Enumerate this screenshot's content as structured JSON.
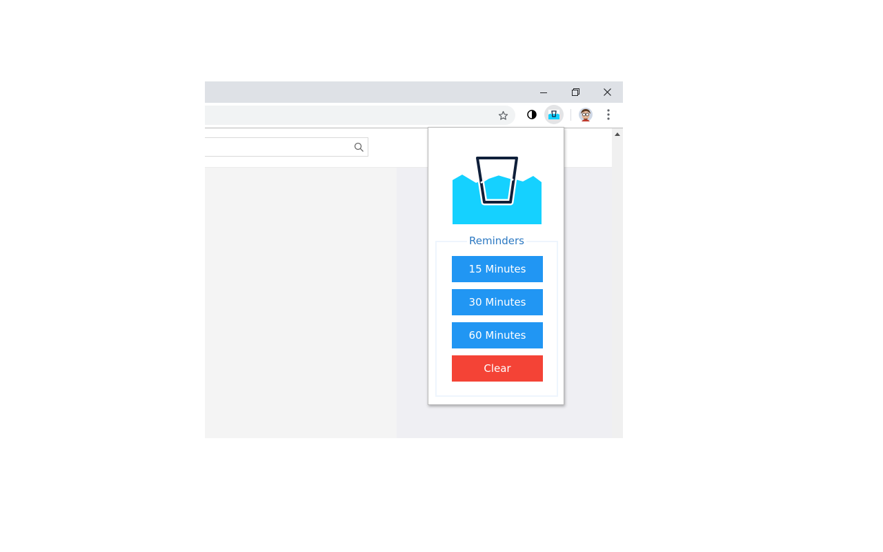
{
  "window": {
    "controls": [
      {
        "name": "minimize",
        "icon": "minimize-icon"
      },
      {
        "name": "restore",
        "icon": "restore-icon"
      },
      {
        "name": "close",
        "icon": "close-icon"
      }
    ]
  },
  "toolbar": {
    "icons": [
      "bookmark-star-icon",
      "contrast-extension-icon",
      "water-reminder-extension-icon",
      "profile-avatar-icon",
      "more-menu-icon"
    ]
  },
  "page": {
    "search": {
      "placeholder": "",
      "value": "",
      "icon": "search-icon"
    }
  },
  "popup": {
    "logo": "water-glass-logo",
    "colors": {
      "water": "#15d1ff",
      "glass_outline": "#0f1f3a",
      "primary": "#2196f3",
      "danger": "#f44336",
      "legend_text": "#2b78c2"
    },
    "section_title": "Reminders",
    "buttons": [
      {
        "label": "15 Minutes",
        "kind": "primary"
      },
      {
        "label": "30 Minutes",
        "kind": "primary"
      },
      {
        "label": "60 Minutes",
        "kind": "primary"
      },
      {
        "label": "Clear",
        "kind": "danger"
      }
    ]
  }
}
